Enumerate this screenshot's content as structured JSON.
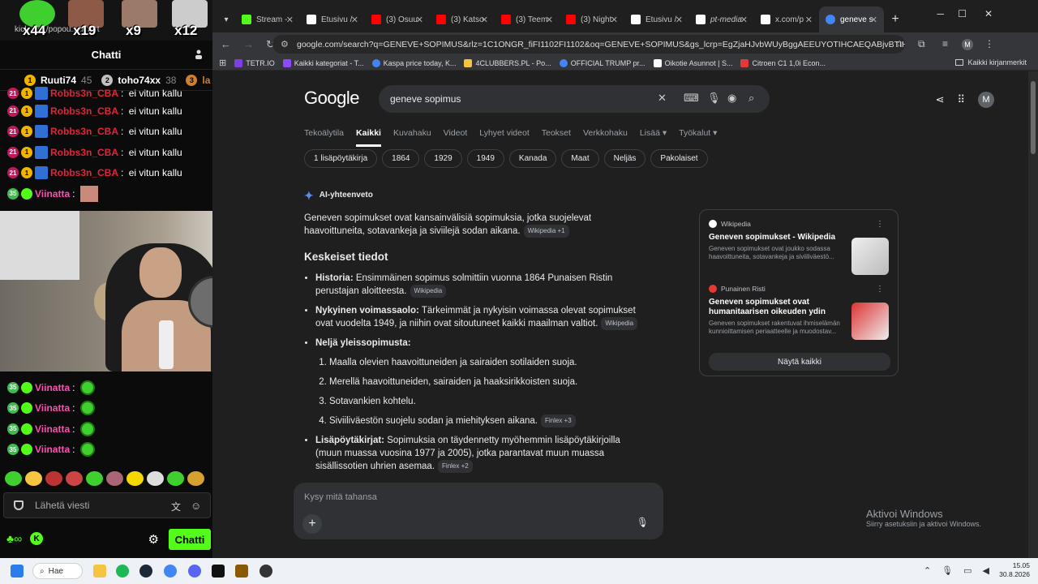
{
  "left": {
    "counters": [
      "x44",
      "x19",
      "x9",
      "x12"
    ],
    "url_fragment": "kick.com/popou...s/chat",
    "chat_title": "Chatti",
    "leaderboard": [
      {
        "rank": "1",
        "name": "Ruuti74",
        "score": "45"
      },
      {
        "rank": "2",
        "name": "toho74xx",
        "score": "38"
      },
      {
        "rank": "3",
        "name": "la",
        "score": ""
      }
    ],
    "chat_top": [
      {
        "badge": "21",
        "user": "Robbs3n_CBA",
        "msg": "ei vitun kallu"
      },
      {
        "badge": "21",
        "user": "Robbs3n_CBA",
        "msg": "ei vitun kallu"
      },
      {
        "badge": "21",
        "user": "Robbs3n_CBA",
        "msg": "ei vitun kallu"
      },
      {
        "badge": "21",
        "user": "Robbs3n_CBA",
        "msg": "ei vitun kallu"
      },
      {
        "badge": "21",
        "user": "Robbs3n_CBA",
        "msg": "ei vitun kallu"
      }
    ],
    "viinatta_top": {
      "badge": "35",
      "user": "Viinatta"
    },
    "chat_bottom": [
      {
        "badge": "35",
        "user": "Viinatta"
      },
      {
        "badge": "35",
        "user": "Viinatta"
      },
      {
        "badge": "35",
        "user": "Viinatta"
      },
      {
        "badge": "35",
        "user": "Viinatta"
      }
    ],
    "send_placeholder": "Lähetä viesti",
    "send_button": "Chatti"
  },
  "browser": {
    "tabs": [
      {
        "label": "Stream -",
        "color": "#53fc18"
      },
      {
        "label": "Etusivu /",
        "color": "#ffffff"
      },
      {
        "label": "(3) Osuu",
        "color": "#ff0000"
      },
      {
        "label": "(3) Katso",
        "color": "#ff0000"
      },
      {
        "label": "(3) Teem",
        "color": "#ff0000"
      },
      {
        "label": "(3) Night",
        "color": "#ff0000"
      },
      {
        "label": "Etusivu /",
        "color": "#ffffff"
      },
      {
        "label": "pt-media",
        "color": "#ffffff"
      },
      {
        "label": "x.com/p",
        "color": "#ffffff"
      },
      {
        "label": "geneve s",
        "color": "#4285f4"
      }
    ],
    "url": "google.com/search?q=GENEVE+SOPIMUS&rlz=1C1ONGR_fiFI1102FI1102&oq=GENEVE+SOPIMUS&gs_lcrp=EgZjaHJvbWUyBggAEEUYOTIHCAEQABjvBTIHCAIQABjvBTIHCA...",
    "bookmarks": [
      "TETR.IO",
      "Kaikki kategoriat - T...",
      "Kaspa price today, K...",
      "4CLUBBERS.PL - Po...",
      "OFFICIAL TRUMP pr...",
      "Oikotie Asunnot | S...",
      "Citroen C1 1,0i Econ..."
    ],
    "all_bookmarks": "Kaikki kirjanmerkit"
  },
  "google": {
    "logo": "Google",
    "query": "geneve sopimus",
    "nav": [
      "Tekoälytila",
      "Kaikki",
      "Kuvahaku",
      "Videot",
      "Lyhyet videot",
      "Teokset",
      "Verkkohaku",
      "Lisää ▾",
      "Työkalut ▾"
    ],
    "chips": [
      "1 lisäpöytäkirja",
      "1864",
      "1929",
      "1949",
      "Kanada",
      "Maat",
      "Neljäs",
      "Pakolaiset"
    ],
    "ai_label": "AI-yhteenveto",
    "intro": "Geneven sopimukset ovat kansainvälisiä sopimuksia, jotka suojelevat haavoittuneita, sotavankeja ja siviilejä sodan aikana.",
    "intro_src": "Wikipedia +1",
    "key_title": "Keskeiset tiedot",
    "facts": [
      {
        "bold": "Historia:",
        "text": " Ensimmäinen sopimus solmittiin vuonna 1864 Punaisen Ristin perustajan aloitteesta.",
        "src": "Wikipedia"
      },
      {
        "bold": "Nykyinen voimassaolo:",
        "text": " Tärkeimmät ja nykyisin voimassa olevat sopimukset ovat vuodelta 1949, ja niihin ovat sitoutuneet kaikki maailman valtiot.",
        "src": "Wikipedia"
      },
      {
        "bold": "Neljä yleissopimusta:",
        "text": "",
        "src": ""
      }
    ],
    "conventions": [
      "Maalla olevien haavoittuneiden ja sairaiden sotilaiden suoja.",
      "Merellä haavoittuneiden, sairaiden ja haaksirikkoisten suoja.",
      "Sotavankien kohtelu.",
      "Siviiliväestön suojelu sodan ja miehityksen aikana."
    ],
    "conventions_src": "Finlex +3",
    "extra": {
      "bold": "Lisäpöytäkirjat:",
      "text": " Sopimuksia on täydennetty myöhemmin lisäpöytäkirjoilla (muun muassa vuosina 1977 ja 2005), jotka parantavat muun muassa sisällissotien uhrien asemaa.",
      "src": "Finlex +2"
    },
    "cards": [
      {
        "source": "Wikipedia",
        "title": "Geneven sopimukset - Wikipedia",
        "snippet": "Geneven sopimukset ovat joukko sodassa haavoittuneita, sotavankeja ja siviiliväestö..."
      },
      {
        "source": "Punainen Risti",
        "title": "Geneven sopimukset ovat humanitaarisen oikeuden ydin",
        "snippet": "Geneven sopimukset rakentuvat ihmiselämän kunnioittamisen periaatteelle ja muodostav..."
      }
    ],
    "show_all": "Näytä kaikki",
    "ask_placeholder": "Kysy mitä tahansa",
    "activate_title": "Aktivoi Windows",
    "activate_sub": "Siirry asetuksiin ja aktivoi Windows."
  },
  "taskbar": {
    "search": "Hae",
    "time": "15.05",
    "date": "30.8.2026"
  }
}
